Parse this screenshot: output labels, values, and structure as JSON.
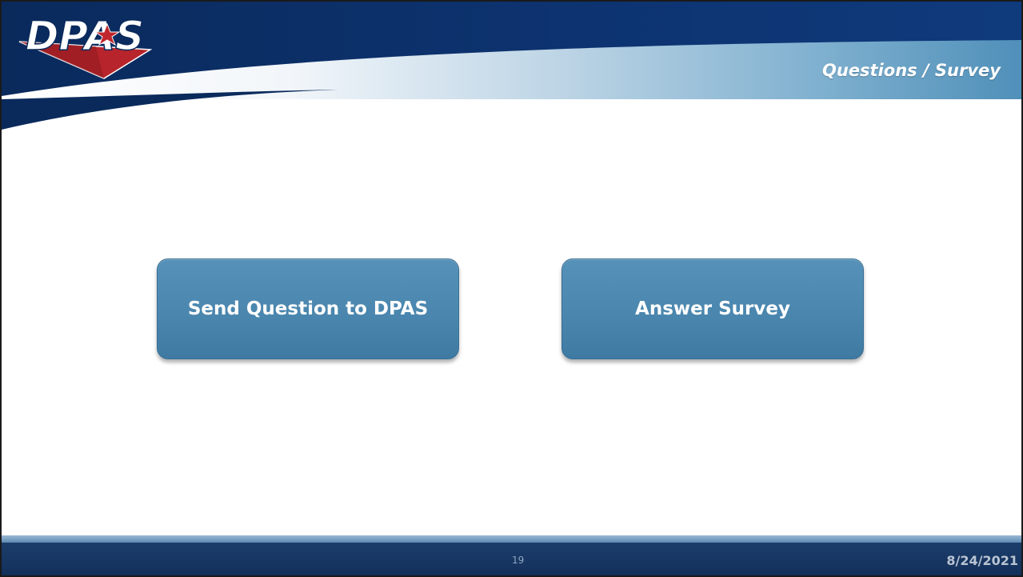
{
  "header": {
    "logo_text": "DPAS",
    "section_title": "Questions / Survey"
  },
  "main": {
    "buttons": [
      {
        "label": "Send Question to DPAS"
      },
      {
        "label": "Answer Survey"
      }
    ]
  },
  "footer": {
    "page_number": "19",
    "date": "8/24/2021"
  },
  "colors": {
    "header_navy": "#0b2e6b",
    "header_light_blue": "#4f8fb9",
    "button_blue": "#4a86ae",
    "logo_red": "#c0272d",
    "footer_navy": "#1c3d6b"
  }
}
